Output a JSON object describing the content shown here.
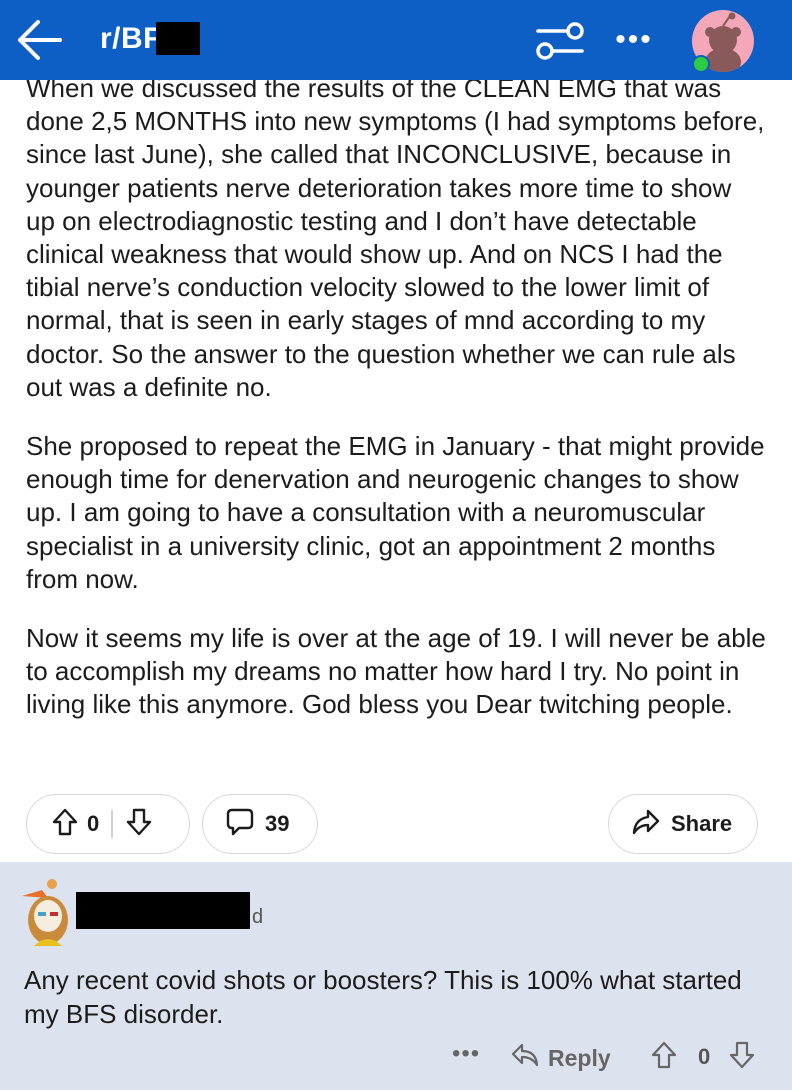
{
  "header": {
    "subreddit": "r/BF",
    "bg_color": "#0d5fc5",
    "icons": [
      "back-arrow-icon",
      "filter-sliders-icon",
      "more-dots-icon",
      "user-avatar-icon"
    ],
    "more_label": "•••"
  },
  "post": {
    "paragraphs": [
      "When we discussed the results of the CLEAN EMG that was done 2,5 MONTHS into new symptoms (I had symptoms before, since last June), she called that INCONCLUSIVE, because in younger patients nerve deterioration takes more time to show up on electrodiagnostic testing and I don’t have detectable clinical weakness that would show up. And on NCS I had the tibial nerve’s conduction velocity slowed to the lower limit of normal, that is seen in early stages of mnd according to my doctor. So the answer to the question whether we can rule als out was a definite no.",
      "She proposed to repeat the EMG in January - that might provide enough time for denervation and neurogenic changes to show up. I am going to have a consultation with a neuromuscular specialist in a university clinic, got an appointment 2 months from now.",
      "Now it seems my life is over at the age of 19. I will never be able to accomplish my dreams no matter how hard I try. No point in living like this anymore. God bless you Dear twitching people."
    ]
  },
  "actions": {
    "score": "0",
    "comments": "39",
    "share_label": "Share"
  },
  "comment": {
    "age": "d",
    "text": "Any recent covid shots or boosters? This is 100% what started my BFS disorder.",
    "more_label": "•••",
    "reply_label": "Reply",
    "score": "0",
    "bg_color": "#dde3ee"
  }
}
